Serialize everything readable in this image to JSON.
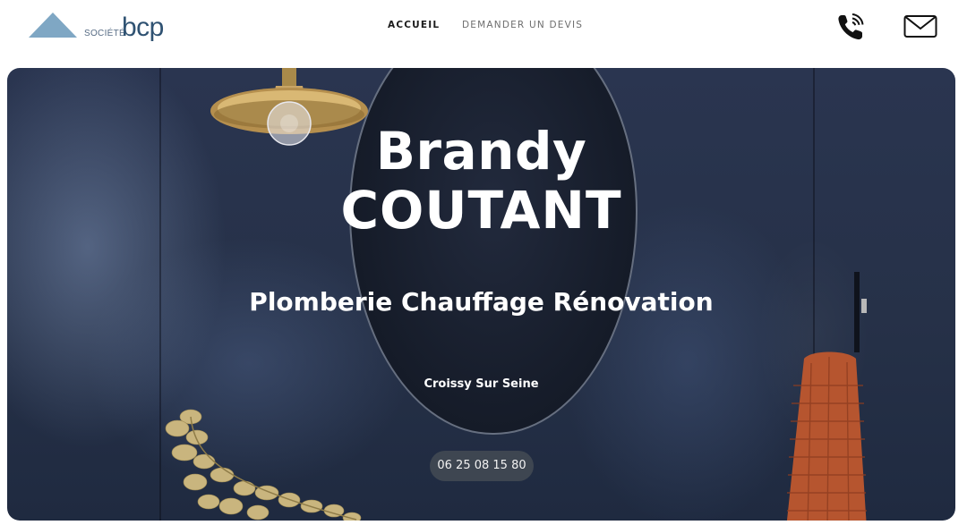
{
  "header": {
    "logo": {
      "prefix": "SOCIÉTÉ",
      "name": "bcp"
    },
    "nav": {
      "home_label": "ACCUEIL",
      "quote_label": "DEMANDER UN DEVIS"
    },
    "icons": {
      "phone": "phone-icon",
      "mail": "mail-icon"
    }
  },
  "hero": {
    "first_name": "Brandy",
    "last_name": "COUTANT",
    "subtitle": "Plomberie Chauffage Rénovation",
    "city": "Croissy Sur Seine",
    "phone": "06 25 08 15 80"
  },
  "colors": {
    "logo_triangle": "#7fa7c4",
    "logo_text": "#2f5272",
    "hero_bg": "#263148",
    "towel": "#b6552f"
  }
}
